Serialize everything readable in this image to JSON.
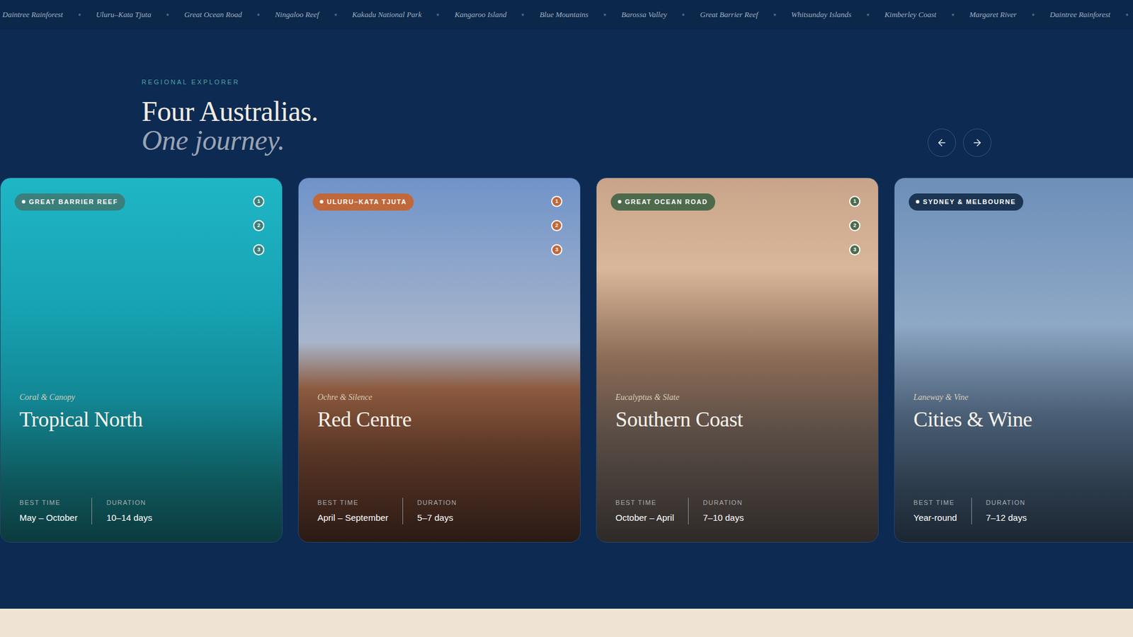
{
  "ticker": [
    "Daintree Rainforest",
    "Uluru–Kata Tjuta",
    "Great Ocean Road",
    "Ningaloo Reef",
    "Kakadu National Park",
    "Kangaroo Island",
    "Blue Mountains",
    "Barossa Valley",
    "Great Barrier Reef",
    "Whitsunday Islands",
    "Kimberley Coast",
    "Margaret River",
    "Daintree Rainforest"
  ],
  "section": {
    "eyebrow": "REGIONAL EXPLORER",
    "title": "Four Australias.",
    "subtitle": "One journey."
  },
  "cards": [
    {
      "badge": "GREAT BARRIER REEF",
      "color": "#3a7f7b",
      "markers": [
        "1",
        "2",
        "3"
      ],
      "tagline": "Coral & Canopy",
      "title": "Tropical North",
      "stats": [
        {
          "label": "BEST TIME",
          "value": "May – October"
        },
        {
          "label": "DURATION",
          "value": "10–14 days"
        }
      ]
    },
    {
      "badge": "ULURU–KATA TJUTA",
      "color": "#c0683a",
      "markers": [
        "1",
        "2",
        "3"
      ],
      "tagline": "Ochre & Silence",
      "title": "Red Centre",
      "stats": [
        {
          "label": "BEST TIME",
          "value": "April – September"
        },
        {
          "label": "DURATION",
          "value": "5–7 days"
        }
      ]
    },
    {
      "badge": "GREAT OCEAN ROAD",
      "color": "#4d6b4c",
      "markers": [
        "1",
        "2",
        "3"
      ],
      "tagline": "Eucalyptus & Slate",
      "title": "Southern Coast",
      "stats": [
        {
          "label": "BEST TIME",
          "value": "October – April"
        },
        {
          "label": "DURATION",
          "value": "7–10 days"
        }
      ]
    },
    {
      "badge": "SYDNEY & MELBOURNE",
      "color": "#1b3553",
      "markers": [],
      "tagline": "Laneway & Vine",
      "title": "Cities & Wine",
      "stats": [
        {
          "label": "BEST TIME",
          "value": "Year-round"
        },
        {
          "label": "DURATION",
          "value": "7–12 days"
        }
      ]
    }
  ]
}
